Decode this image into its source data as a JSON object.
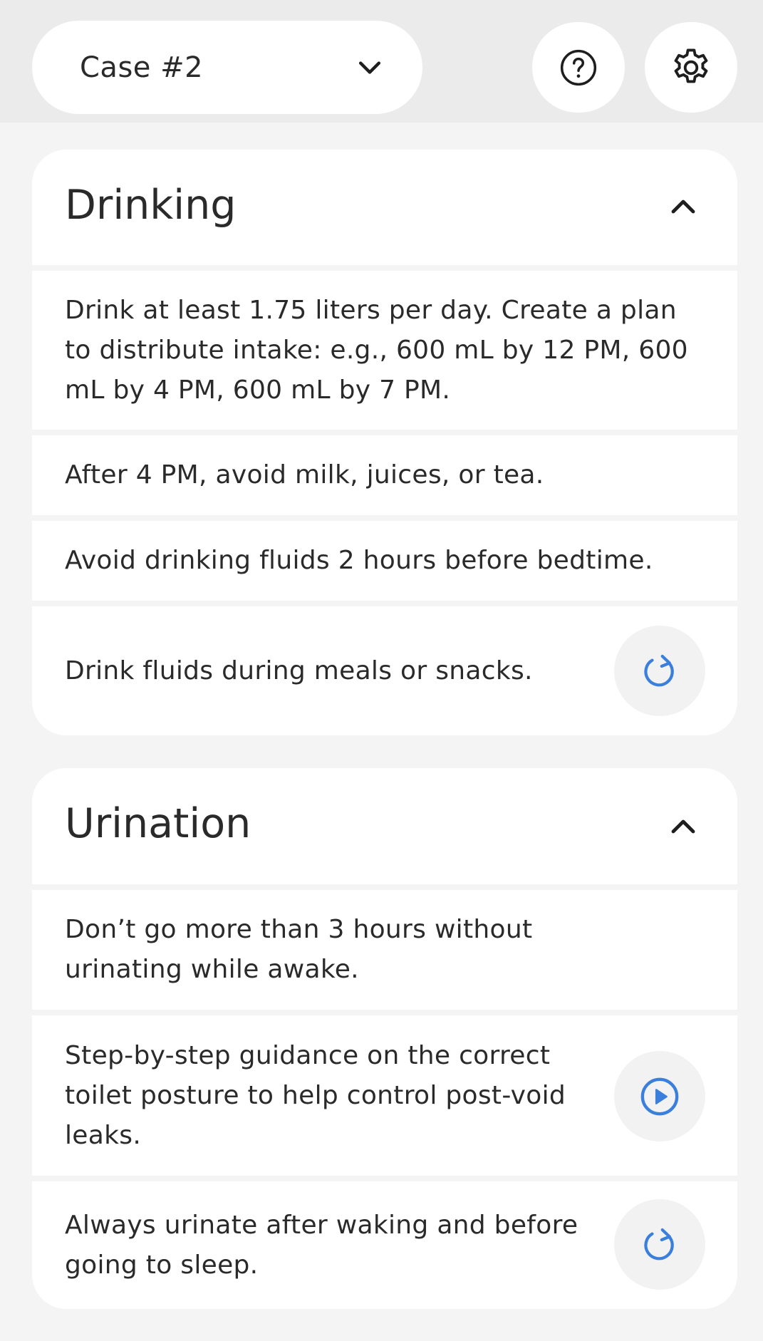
{
  "header": {
    "case_selector": "Case #2"
  },
  "sections": [
    {
      "title": "Drinking",
      "items": [
        "Drink at least 1.75 liters per day. Create a plan to distribute intake: e.g., 600 mL by 12 PM, 600 mL by 4 PM, 600 mL by 7 PM.",
        "After 4 PM, avoid milk, juices, or tea.",
        "Avoid drinking fluids 2 hours before bedtime.",
        "Drink fluids during meals or snacks."
      ]
    },
    {
      "title": "Urination",
      "items": [
        "Don’t go more than 3 hours without urinating while awake.",
        "Step-by-step guidance on the correct toilet posture to help control post-void leaks.",
        "Always urinate after waking and before going to sleep."
      ]
    }
  ],
  "icons": {
    "chevron_down": "chevron-down-icon",
    "help": "help-circle-icon",
    "settings": "gear-icon",
    "chevron_up": "chevron-up-icon",
    "refresh": "refresh-icon",
    "play": "play-circle-icon"
  },
  "colors": {
    "accent": "#3a7fdc",
    "background": "#f4f4f4",
    "header_background": "#ebebeb",
    "card": "#ffffff"
  }
}
